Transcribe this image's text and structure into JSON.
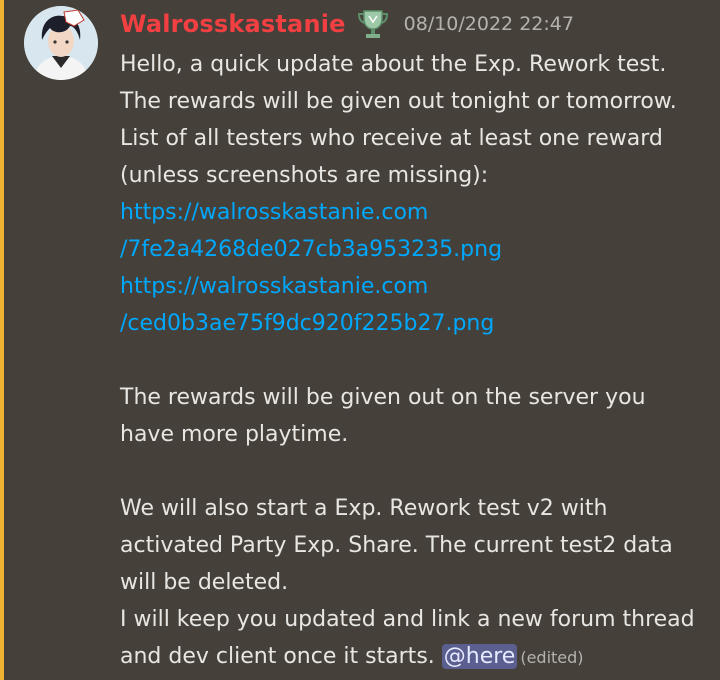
{
  "author": {
    "name": "Walrosskastanie",
    "role_icon": "trophy-icon",
    "timestamp": "08/10/2022 22:47"
  },
  "message": {
    "lines": [
      "Hello, a quick update about the Exp. Rework test.",
      "The rewards will be given out tonight or tomorrow.",
      "List of all testers who receive at least one reward",
      "(unless screenshots are missing):"
    ],
    "links": [
      {
        "line1": "https://walrosskastanie.com",
        "line2": "/7fe2a4268de027cb3a953235.png"
      },
      {
        "line1": "https://walrosskastanie.com",
        "line2": "/ced0b3ae75f9dc920f225b27.png"
      }
    ],
    "paragraph2": [
      "The rewards will be given out on the server you",
      "have more playtime."
    ],
    "paragraph3": [
      "We will also start a Exp. Rework test v2 with",
      "activated Party Exp. Share. The current test2 data",
      "will be deleted.",
      "I will keep you updated and link a new forum thread"
    ],
    "last_line_text": "and dev client once it starts. ",
    "mention": "@here",
    "edited_label": "(edited)"
  },
  "colors": {
    "background": "#45403a",
    "username": "#f23f42",
    "link": "#00a8fc",
    "mention_bg": "#5a5f8f"
  }
}
